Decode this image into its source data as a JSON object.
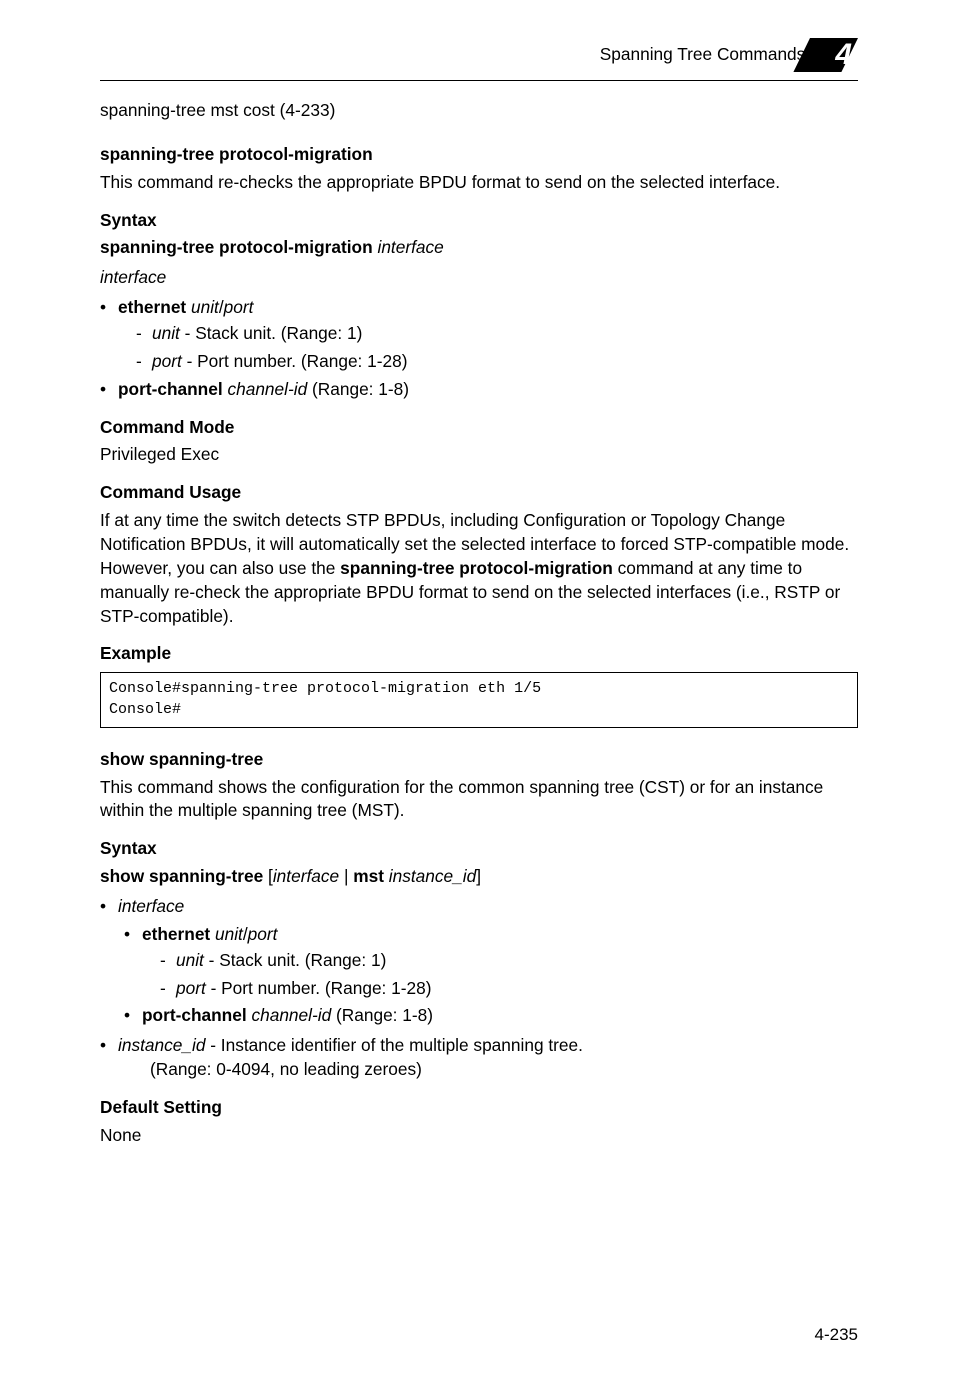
{
  "header": {
    "section_title": "Spanning Tree Commands",
    "chapter_number": "4"
  },
  "top_ref": "spanning-tree mst cost (4-233)",
  "sec1": {
    "heading": "spanning-tree protocol-migration",
    "desc": "This command re-checks the appropriate BPDU format to send on the selected interface.",
    "syntax_label": "Syntax",
    "syntax_cmd_bold": "spanning-tree protocol-migration",
    "syntax_cmd_ital": " interface",
    "interface_label": "interface",
    "eth_bold": "ethernet",
    "eth_ital": " unit",
    "eth_sep": "/",
    "eth_port_ital": "port",
    "unit_ital": "unit",
    "unit_desc": " - Stack unit. (Range: 1)",
    "port_ital": "port",
    "port_desc": " - Port number. (Range: 1-28)",
    "pc_bold": "port-channel",
    "pc_ital": " channel-id",
    "pc_desc": " (Range: 1-8)",
    "cmd_mode_label": "Command Mode",
    "cmd_mode_value": "Privileged Exec",
    "cmd_usage_label": "Command Usage",
    "cmd_usage_p1": "If at any time the switch detects STP BPDUs, including Configuration or Topology Change Notification BPDUs, it will automatically set the selected interface to forced STP-compatible mode. However, you can also use the ",
    "cmd_usage_bold": "spanning-tree protocol-migration",
    "cmd_usage_p2": " command at any time to manually re-check the appropriate BPDU format to send on the selected interfaces (i.e., RSTP or STP-compatible).",
    "example_label": "Example",
    "example_code": "Console#spanning-tree protocol-migration eth 1/5\nConsole#"
  },
  "sec2": {
    "heading": "show spanning-tree",
    "desc": "This command shows the configuration for the common spanning tree (CST) or for an instance within the multiple spanning tree (MST).",
    "syntax_label": "Syntax",
    "syntax_cmd_bold1": "show spanning-tree",
    "syntax_bracket_open": " [",
    "syntax_ital1": "interface",
    "syntax_pipe": " | ",
    "syntax_cmd_bold2": "mst",
    "syntax_ital2": " instance_id",
    "syntax_bracket_close": "]",
    "interface_label": "interface",
    "eth_bold": "ethernet",
    "eth_ital": " unit",
    "eth_sep": "/",
    "eth_port_ital": "port",
    "unit_ital": "unit",
    "unit_desc": " - Stack unit. (Range: 1)",
    "port_ital": "port",
    "port_desc": " - Port number. (Range: 1-28)",
    "pc_bold": "port-channel",
    "pc_ital": " channel-id",
    "pc_desc": " (Range: 1-8)",
    "instance_ital": "instance_id",
    "instance_desc": " - Instance identifier of the multiple spanning tree.",
    "instance_range": "(Range: 0-4094, no leading zeroes)",
    "default_label": "Default Setting",
    "default_value": "None"
  },
  "page_number": "4-235"
}
